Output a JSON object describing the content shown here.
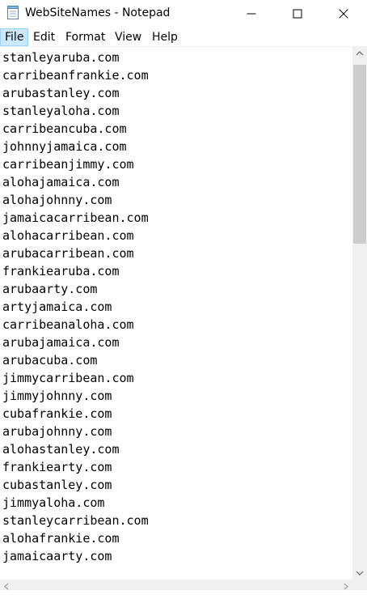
{
  "window": {
    "title": "WebSiteNames - Notepad"
  },
  "menu": [
    "File",
    "Edit",
    "Format",
    "View",
    "Help"
  ],
  "menu_active_index": 0,
  "document": {
    "lines": [
      "stanleyaruba.com",
      "carribeanfrankie.com",
      "arubastanley.com",
      "stanleyaloha.com",
      "carribeancuba.com",
      "johnnyjamaica.com",
      "carribeanjimmy.com",
      "alohajamaica.com",
      "alohajohnny.com",
      "jamaicacarribean.com",
      "alohacarribean.com",
      "arubacarribean.com",
      "frankiearuba.com",
      "arubaarty.com",
      "artyjamaica.com",
      "carribeanaloha.com",
      "arubajamaica.com",
      "arubacuba.com",
      "jimmycarribean.com",
      "jimmyjohnny.com",
      "cubafrankie.com",
      "arubajohnny.com",
      "alohastanley.com",
      "frankiearty.com",
      "cubastanley.com",
      "jimmyaloha.com",
      "stanleycarribean.com",
      "alohafrankie.com",
      "jamaicaarty.com"
    ]
  },
  "icons": {
    "app": "notepad-icon",
    "minimize": "minimize-icon",
    "maximize": "maximize-icon",
    "close": "close-icon"
  }
}
